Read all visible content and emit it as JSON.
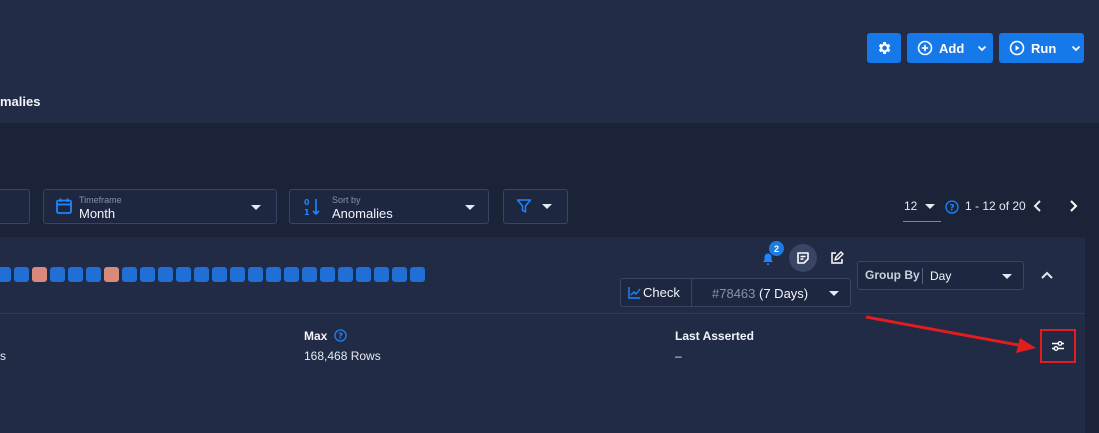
{
  "header": {
    "tab_partial": "malies",
    "buttons": {
      "add": "Add",
      "run": "Run"
    }
  },
  "filters": {
    "timeframe": {
      "label": "Timeframe",
      "value": "Month"
    },
    "sort": {
      "label": "Sort by",
      "value": "Anomalies"
    }
  },
  "pagination": {
    "page_size": "12",
    "range": "1 - 12 of 20"
  },
  "card": {
    "notification_count": "2",
    "check": {
      "label": "Check",
      "id": "#78463",
      "window": "(7 Days)"
    },
    "group_by": {
      "label": "Group By",
      "value": "Day"
    },
    "status_squares": [
      "ok",
      "ok",
      "red",
      "ok",
      "ok",
      "ok",
      "red",
      "ok",
      "ok",
      "ok",
      "ok",
      "ok",
      "ok",
      "ok",
      "ok",
      "ok",
      "ok",
      "ok",
      "ok",
      "ok",
      "ok",
      "ok",
      "ok",
      "ok"
    ],
    "stats": {
      "partial_value": "s",
      "max": {
        "label": "Max",
        "value": "168,468 Rows"
      },
      "last_asserted": {
        "label": "Last Asserted",
        "value": "–"
      }
    }
  },
  "colors": {
    "accent": "#1679ea",
    "anomaly": "#d98a7c",
    "highlight": "#e11d1d"
  }
}
